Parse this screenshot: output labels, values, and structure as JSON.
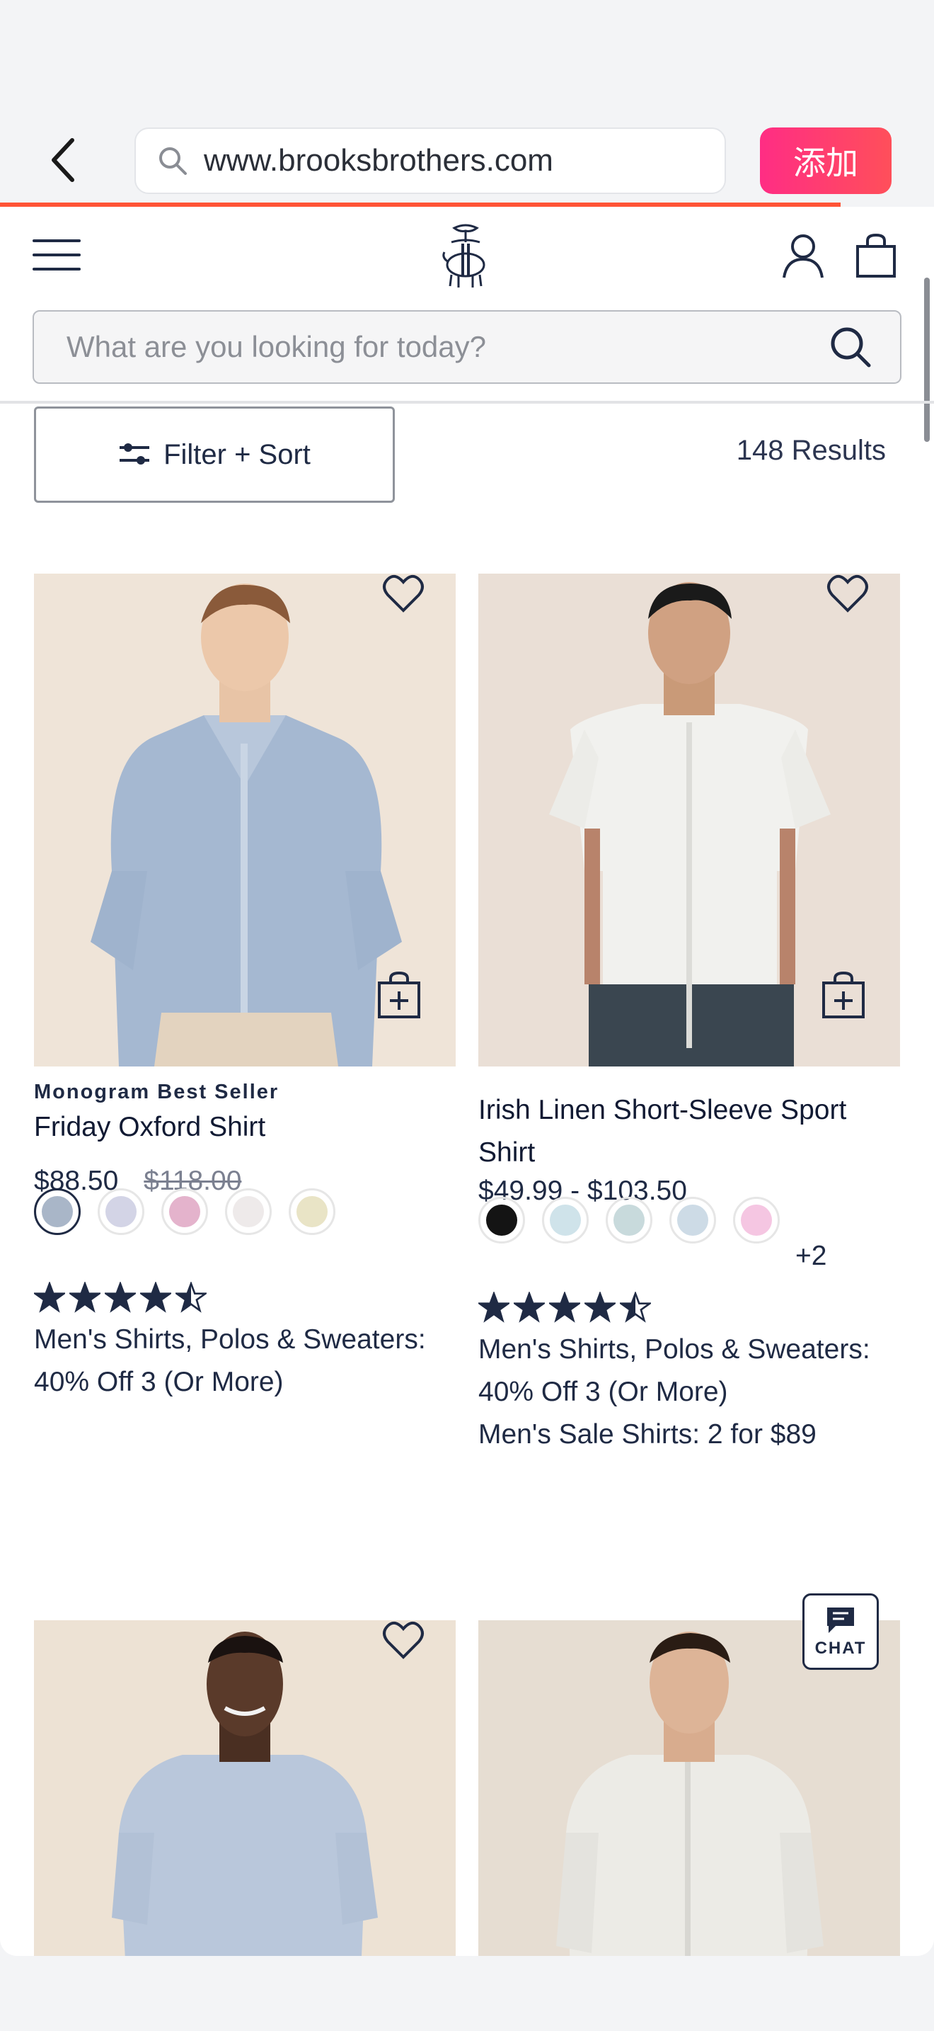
{
  "browser": {
    "url": "www.brooksbrothers.com",
    "add_button_label": "添加",
    "load_progress": 0.9
  },
  "header": {
    "search_placeholder": "What are you looking for today?",
    "icons": [
      "menu-icon",
      "brooks-brothers-logo",
      "account-icon",
      "shopping-bag-icon",
      "search-icon"
    ]
  },
  "toolbar": {
    "filter_label": "Filter + Sort",
    "results_label": "148 Results"
  },
  "products": [
    {
      "badge": "Monogram Best Seller",
      "name": "Friday Oxford Shirt",
      "price": "$88.50",
      "original_price": "$118.00",
      "swatches": [
        "#a9b6c8",
        "#d3d4e6",
        "#e4b3cc",
        "#eeeaea",
        "#e9e4c6"
      ],
      "selected_swatch": 0,
      "rating": 4.5,
      "promos": [
        "Men's Shirts, Polos & Sweaters: 40% Off 3 (Or More)"
      ]
    },
    {
      "name": "Irish Linen Short-Sleeve Sport Shirt",
      "price": "$49.99 - $103.50",
      "swatches": [
        "#141414",
        "#cfe3ea",
        "#c8dadc",
        "#cddbe6",
        "#f5c6e2"
      ],
      "more_colors": "+2",
      "rating": 4.5,
      "promos": [
        "Men's Shirts, Polos & Sweaters: 40% Off 3 (Or More)",
        "Men's Sale Shirts: 2 for $89"
      ]
    },
    {},
    {}
  ],
  "chat": {
    "label": "CHAT"
  },
  "colors": {
    "accent_pink": "#ff2d84",
    "navy": "#1f2a44",
    "progress": "#ff5436"
  }
}
